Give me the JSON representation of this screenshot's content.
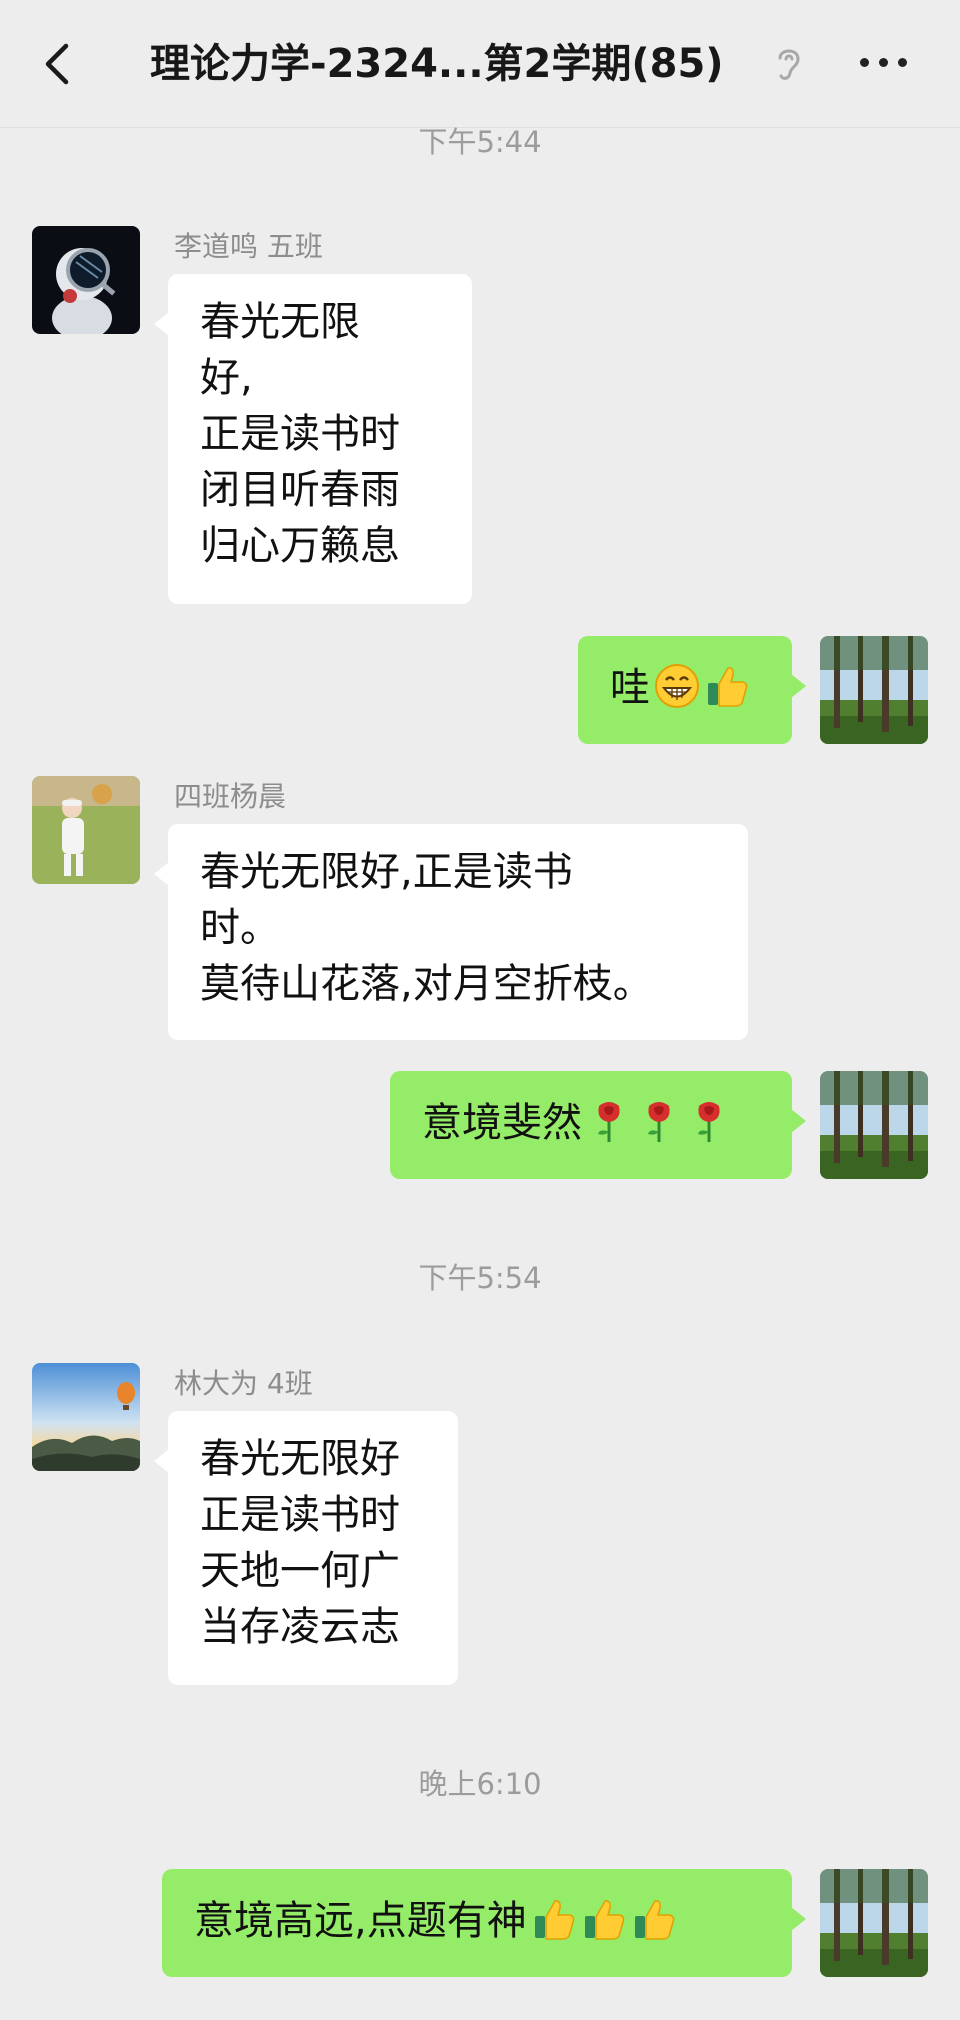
{
  "header": {
    "title": "理论力学-2324...第2学期(85)",
    "back_icon": "chevron-left-icon",
    "ear_icon": "ear-icon",
    "more_icon": "more-dots-icon"
  },
  "timestamps": [
    "下午5:44",
    "下午5:54",
    "晚上6:10"
  ],
  "messages": [
    {
      "side": "left",
      "sender": "李道鸣 五班",
      "lines": [
        "春光无限",
        "好,",
        "正是读书时",
        "闭目听春雨",
        "归心万籁息"
      ]
    },
    {
      "side": "right",
      "text": "哇",
      "emojis": [
        "grin-emoji",
        "thumbs-up-emoji"
      ]
    },
    {
      "side": "left",
      "sender": "四班杨晨",
      "lines": [
        "春光无限好,正是读书",
        "时。",
        "莫待山花落,对月空折枝。"
      ]
    },
    {
      "side": "right",
      "text": "意境斐然",
      "emojis": [
        "rose-emoji",
        "rose-emoji",
        "rose-emoji"
      ]
    },
    {
      "side": "left",
      "sender": "林大为 4班",
      "lines": [
        "春光无限好",
        "正是读书时",
        "天地一何广",
        "当存凌云志"
      ]
    },
    {
      "side": "right",
      "text": "意境高远,点题有神",
      "emojis": [
        "thumbs-up-emoji",
        "thumbs-up-emoji",
        "thumbs-up-emoji"
      ]
    }
  ],
  "colors": {
    "background": "#ededed",
    "self_bubble": "#95ec69",
    "other_bubble": "#ffffff",
    "timestamp_text": "#9c9c9c",
    "sender_text": "#8d8d8d"
  }
}
